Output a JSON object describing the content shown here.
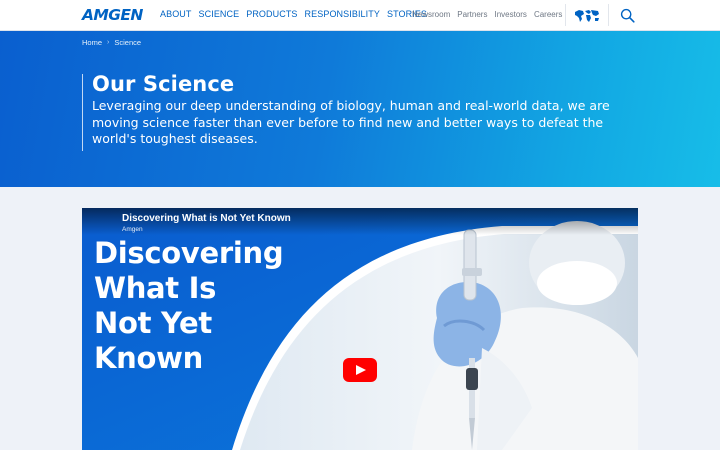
{
  "header": {
    "logo": "AMGEN",
    "main_nav": [
      "ABOUT",
      "SCIENCE",
      "PRODUCTS",
      "RESPONSIBILITY",
      "STORIES"
    ],
    "secondary_nav": [
      "Newsroom",
      "Partners",
      "Investors",
      "Careers"
    ]
  },
  "breadcrumb": {
    "home": "Home",
    "current": "Science"
  },
  "hero": {
    "title": "Our Science",
    "description": "Leveraging our deep understanding of biology, human and real-world data, we are moving science faster than ever before to find new and better ways to defeat the world's toughest diseases."
  },
  "video": {
    "title": "Discovering What is Not Yet Known",
    "channel": "Amgen",
    "headline_lines": [
      "Discovering",
      "What Is",
      "Not Yet",
      "Known"
    ]
  },
  "colors": {
    "brand_blue": "#0063c3",
    "hero_gradient_start": "#0a5fcf",
    "hero_gradient_end": "#17bde8",
    "play_red": "#ff0000"
  },
  "icons": {
    "world": "world-map-icon",
    "search": "search-icon",
    "play": "youtube-play-icon"
  }
}
